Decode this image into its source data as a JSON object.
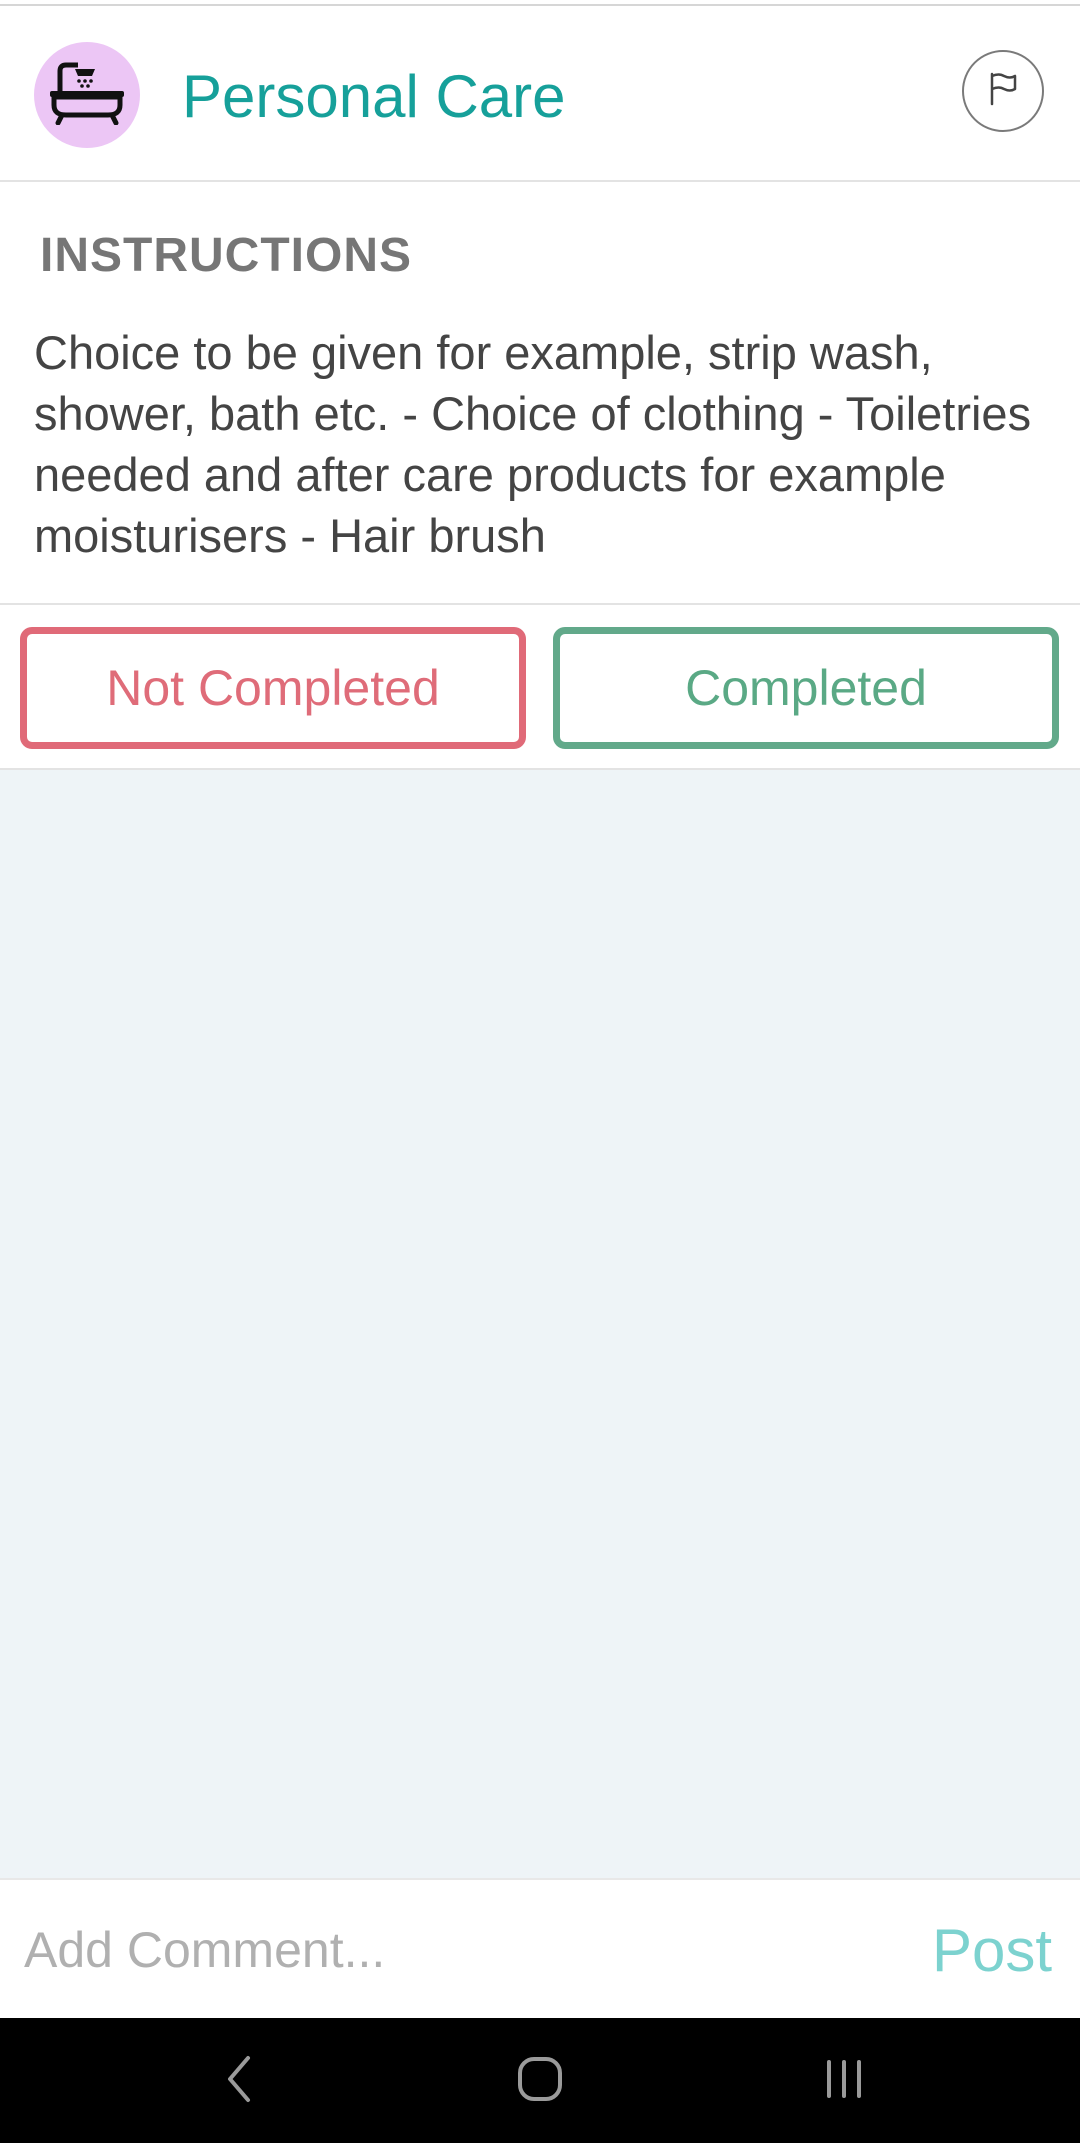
{
  "header": {
    "title": "Personal Care",
    "avatar_icon": "bathtub-icon",
    "avatar_color": "#ecc6f5",
    "flag_icon": "flag-icon"
  },
  "instructions": {
    "heading": "INSTRUCTIONS",
    "body": "Choice to be given for example, strip wash, shower, bath etc. - Choice of clothing - Toiletries needed and after care products for example moisturisers - Hair brush"
  },
  "actions": {
    "not_completed_label": "Not Completed",
    "completed_label": "Completed",
    "not_completed_color": "#e06a78",
    "completed_color": "#62a98a"
  },
  "comment": {
    "placeholder": "Add Comment...",
    "post_label": "Post"
  },
  "nav": {
    "back_icon": "back-chevron-icon",
    "home_icon": "home-icon",
    "recents_icon": "recents-icon"
  },
  "colors": {
    "title": "#16a09a",
    "content_background": "#eef4f7",
    "post": "#7cd2cf"
  }
}
